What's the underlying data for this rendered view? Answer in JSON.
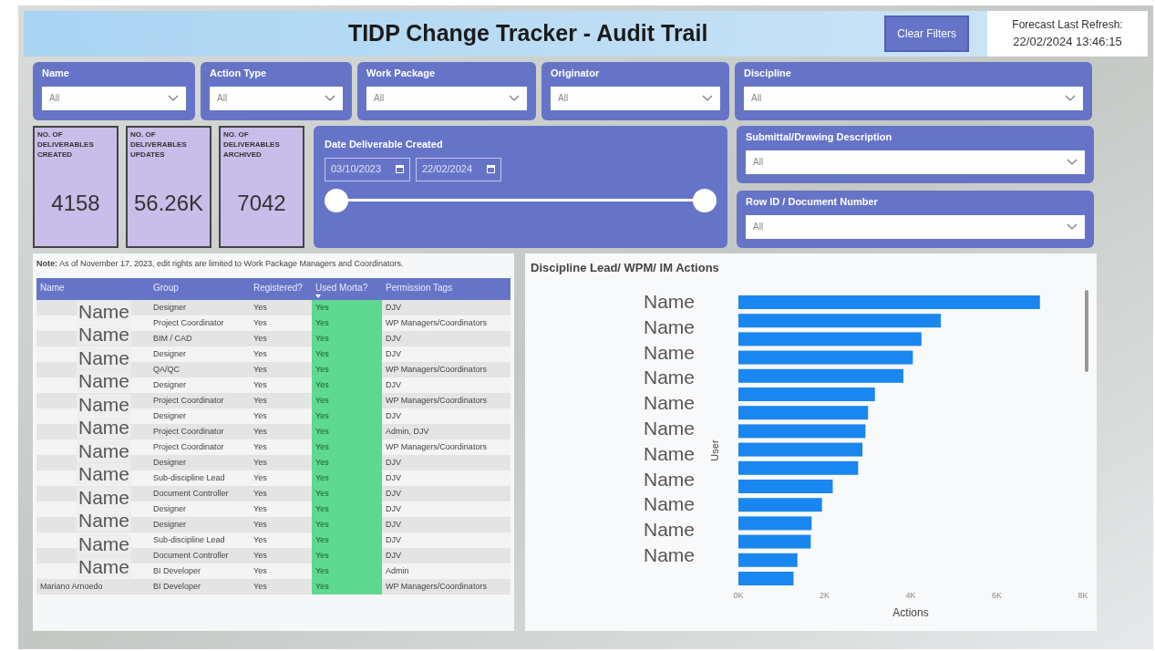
{
  "header": {
    "title": "TIDP Change Tracker - Audit Trail",
    "clear_button": "Clear Filters",
    "refresh_label": "Forecast Last Refresh:",
    "refresh_time": "22/02/2024 13:46:15"
  },
  "slicers_top": [
    {
      "label": "Name",
      "value": "All"
    },
    {
      "label": "Action Type",
      "value": "All"
    },
    {
      "label": "Work Package",
      "value": "All"
    },
    {
      "label": "Originator",
      "value": "All"
    },
    {
      "label": "Discipline",
      "value": "All"
    }
  ],
  "kpis": [
    {
      "label": "NO. OF DELIVERABLES CREATED",
      "value": "4158"
    },
    {
      "label": "NO. OF DELIVERABLES UPDATES",
      "value": "56.26K"
    },
    {
      "label": "NO. OF DELIVERABLES ARCHIVED",
      "value": "7042"
    }
  ],
  "date_slicer": {
    "label": "Date Deliverable Created",
    "start": "03/10/2023",
    "end": "22/02/2024",
    "handles": [
      {
        "level": 0
      },
      {
        "level": 1
      }
    ]
  },
  "slicers_right": [
    {
      "label": "Submittal/Drawing Description",
      "value": "All"
    },
    {
      "label": "Row ID / Document Number",
      "value": "All"
    }
  ],
  "note": "**Note:** As of November 17, 2023, edit rights are limited to Work Package Managers and Coordinators.",
  "table": {
    "columns": [
      "Name",
      "Group",
      "Registered?",
      "Used Morta?",
      "Permission Tags"
    ],
    "name_overlays": [
      "Name",
      "Name",
      "Name",
      "Name",
      "Name",
      "Name",
      "Name",
      "Name",
      "Name",
      "Name",
      "Name",
      "Name"
    ],
    "rows": [
      {
        "group": "Designer",
        "registered": "Yes",
        "used": "Yes",
        "tags": "DJV"
      },
      {
        "group": "Project Coordinator",
        "registered": "Yes",
        "used": "Yes",
        "tags": "WP Managers/Coordinators"
      },
      {
        "group": "BIM / CAD",
        "registered": "Yes",
        "used": "Yes",
        "tags": "DJV"
      },
      {
        "group": "Designer",
        "registered": "Yes",
        "used": "Yes",
        "tags": "DJV"
      },
      {
        "group": "QA/QC",
        "registered": "Yes",
        "used": "Yes",
        "tags": "WP Managers/Coordinators"
      },
      {
        "group": "Designer",
        "registered": "Yes",
        "used": "Yes",
        "tags": "DJV"
      },
      {
        "group": "Project Coordinator",
        "registered": "Yes",
        "used": "Yes",
        "tags": "WP Managers/Coordinators"
      },
      {
        "group": "Designer",
        "registered": "Yes",
        "used": "Yes",
        "tags": "DJV"
      },
      {
        "group": "Project Coordinator",
        "registered": "Yes",
        "used": "Yes",
        "tags": "Admin, DJV"
      },
      {
        "group": "Project Coordinator",
        "registered": "Yes",
        "used": "Yes",
        "tags": "WP Managers/Coordinators"
      },
      {
        "group": "Designer",
        "registered": "Yes",
        "used": "Yes",
        "tags": "DJV"
      },
      {
        "group": "Sub-discipline Lead",
        "registered": "Yes",
        "used": "Yes",
        "tags": "DJV"
      },
      {
        "group": "Document Controller",
        "registered": "Yes",
        "used": "Yes",
        "tags": "DJV"
      },
      {
        "group": "Designer",
        "registered": "Yes",
        "used": "Yes",
        "tags": "DJV"
      },
      {
        "group": "Designer",
        "registered": "Yes",
        "used": "Yes",
        "tags": "DJV"
      },
      {
        "group": "Sub-discipline Lead",
        "registered": "Yes",
        "used": "Yes",
        "tags": "DJV"
      },
      {
        "group": "Document Controller",
        "registered": "Yes",
        "used": "Yes",
        "tags": "DJV"
      },
      {
        "group": "BI Developer",
        "registered": "Yes",
        "used": "Yes",
        "tags": "Admin"
      },
      {
        "name": "Mariano Arnoedo",
        "group": "BI Developer",
        "registered": "Yes",
        "used": "Yes",
        "tags": "WP Managers/Coordinators"
      }
    ]
  },
  "chart": {
    "name_overlays": [
      "Name",
      "Name",
      "Name",
      "Name",
      "Name",
      "Name",
      "Name",
      "Name",
      "Name",
      "Name",
      "Name"
    ],
    "chart_data": {
      "type": "bar",
      "title": "Discipline Lead/ WPM/ IM Actions",
      "xlabel": "Actions",
      "ylabel": "User",
      "orientation": "horizontal",
      "series": [
        {
          "color": "#1a86f0",
          "values": [
            7000,
            4700,
            4250,
            4050,
            3830,
            3170,
            3010,
            2950,
            2880,
            2780,
            2190,
            1940,
            1700,
            1680,
            1370,
            1280
          ]
        }
      ],
      "xlim": [
        0,
        8000
      ],
      "xticks": [
        {
          "value": 0,
          "label": "0K"
        },
        {
          "value": 2000,
          "label": "2K"
        },
        {
          "value": 4000,
          "label": "4K"
        },
        {
          "value": 6000,
          "label": "6K"
        },
        {
          "value": 8000,
          "label": "8K"
        }
      ]
    }
  }
}
